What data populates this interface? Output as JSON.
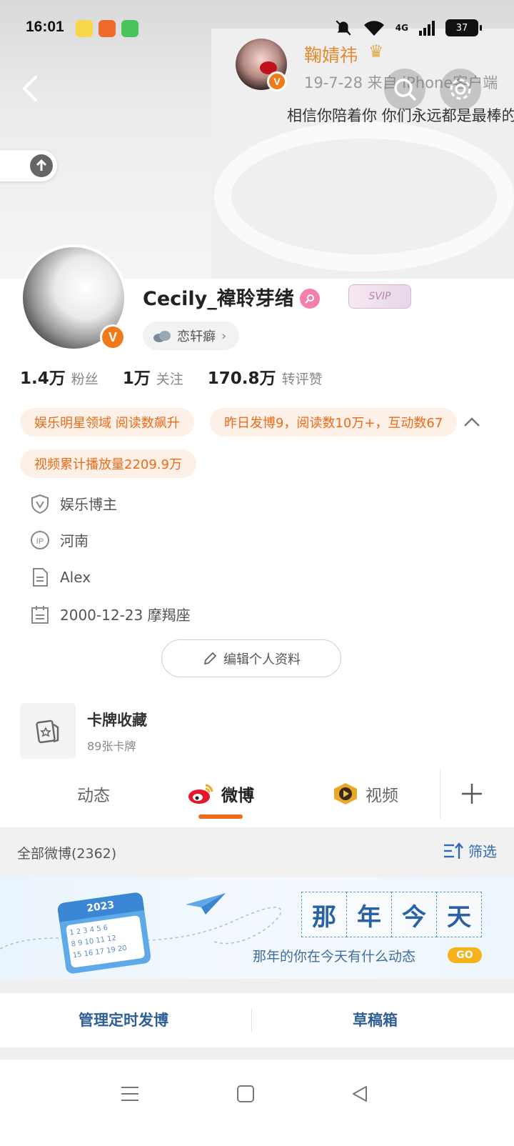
{
  "status_bar": {
    "time": "16:01",
    "network": "4G",
    "battery": "37"
  },
  "top_post": {
    "name": "鞠婧祎",
    "meta": "19-7-28   来自 iPhone客户端",
    "text": "相信你陪着你 你们永远都是最棒的"
  },
  "profile": {
    "username": "Cecily_褘聆芽绪",
    "svip_label": "SVIP",
    "tag_label": "恋轩癖",
    "stats": [
      {
        "num": "1.4万",
        "label": "粉丝"
      },
      {
        "num": "1万",
        "label": "关注"
      },
      {
        "num": "170.8万",
        "label": "转评赞"
      }
    ],
    "highlights": [
      "娱乐明星领域 阅读数飙升",
      "昨日发博9，阅读数10万+，互动数67",
      "视频累计播放量2209.9万"
    ],
    "info": {
      "role": "娱乐博主",
      "ip": "河南",
      "desc": "Alex",
      "birthday": "2000-12-23 摩羯座"
    },
    "edit_button": "编辑个人资料"
  },
  "card": {
    "title": "卡牌收藏",
    "subtitle": "89张卡牌"
  },
  "tabs": [
    {
      "label": "动态"
    },
    {
      "label": "微博"
    },
    {
      "label": "视频"
    }
  ],
  "feed": {
    "count_label": "全部微博(2362)",
    "filter_label": "筛选"
  },
  "banner": {
    "calendar_year": "2023",
    "calendar_digits": "1 2 3 4 5 6\n8 9 10 11 12\n15 16 17 19 20",
    "chars": [
      "那",
      "年",
      "今",
      "天"
    ],
    "subtitle": "那年的你在今天有什么动态",
    "go": "GO"
  },
  "actions": {
    "scheduled": "管理定时发博",
    "drafts": "草稿箱"
  },
  "colors": {
    "accent": "#ef6b1c",
    "link": "#2f5f95",
    "highlight_bg": "#fdf0e6"
  },
  "icons": [
    "back-icon",
    "search-icon",
    "settings-icon",
    "scroll-up-icon",
    "female-icon",
    "shield-v-icon",
    "ip-icon",
    "document-icon",
    "calendar-icon",
    "pencil-icon",
    "card-icon",
    "weibo-icon",
    "video-icon",
    "plus-icon",
    "filter-icon",
    "menu-icon",
    "home-icon",
    "back-triangle-icon"
  ]
}
